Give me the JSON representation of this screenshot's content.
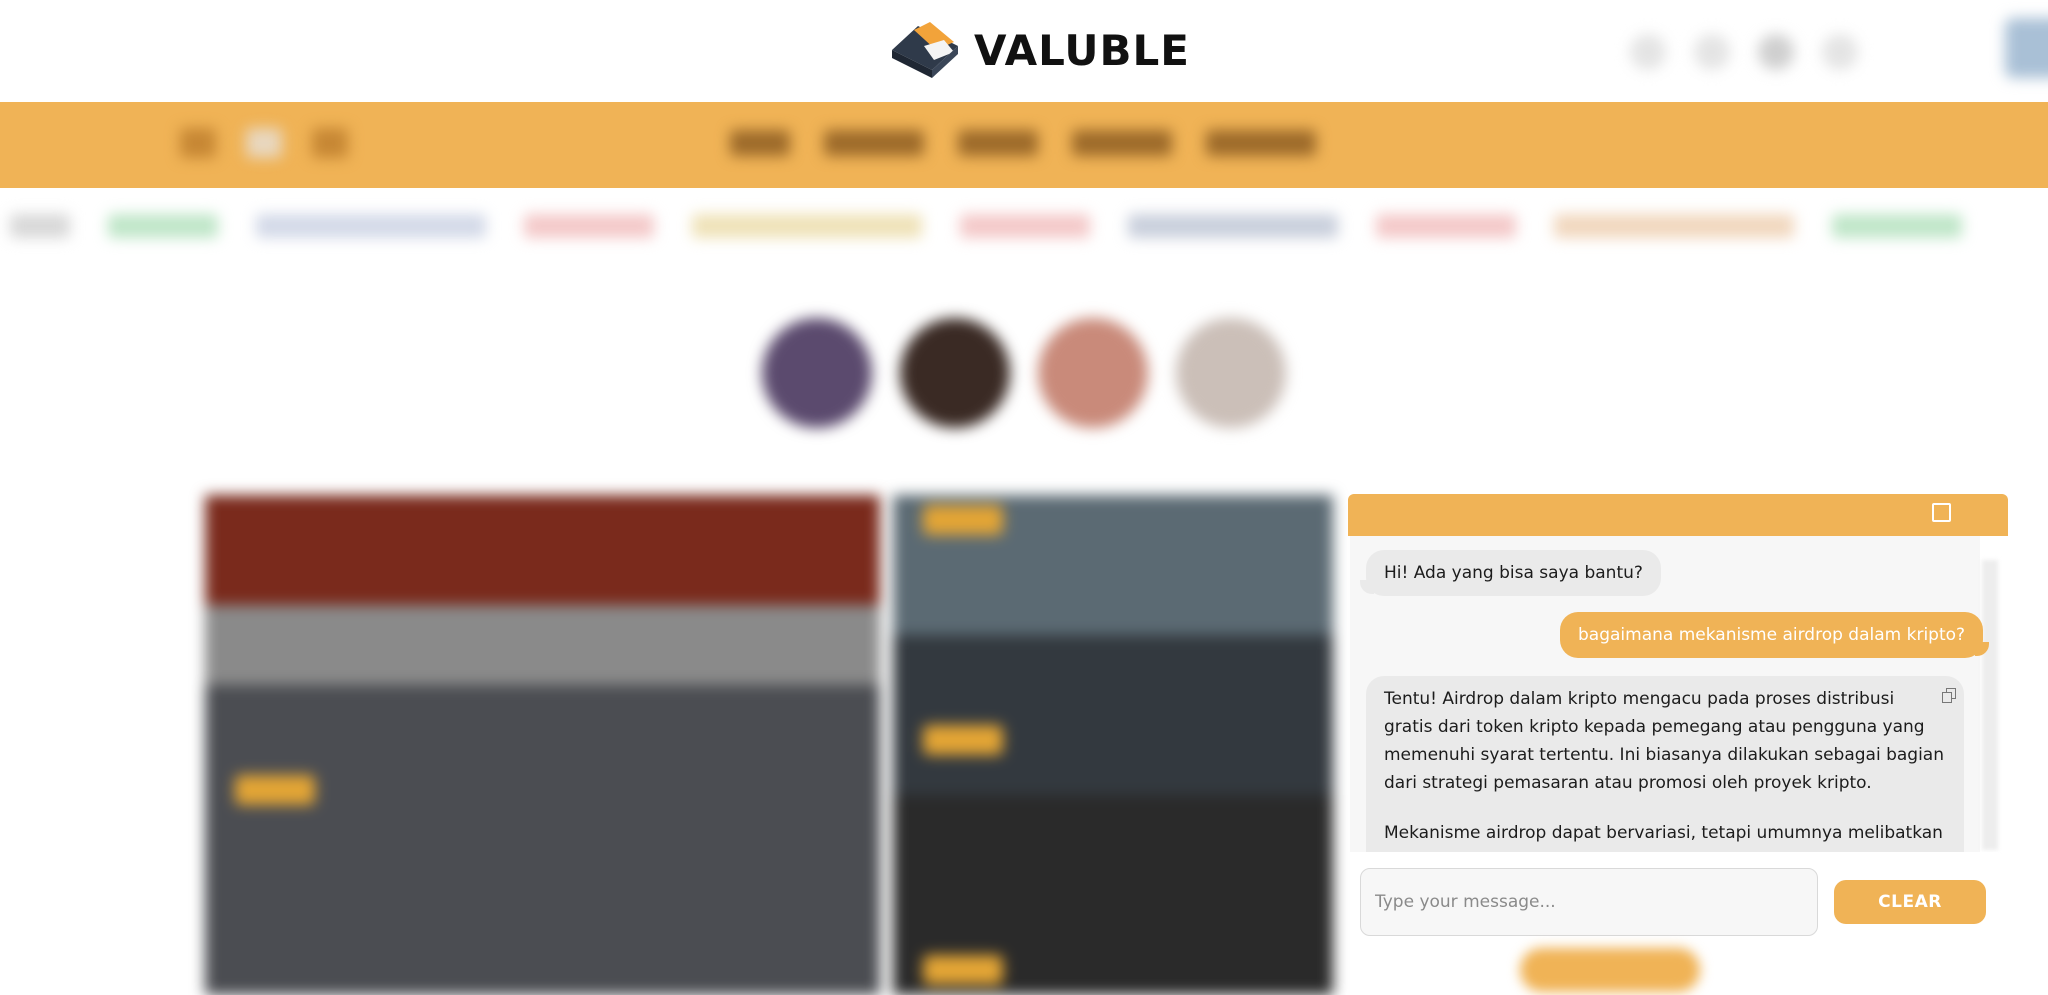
{
  "brand": {
    "name": "VALUBLE",
    "colors": {
      "accent": "#f0b356",
      "logo_dark": "#2f3a4a",
      "logo_orange": "#f2a33a",
      "logo_light": "#f4f4f4"
    }
  },
  "header": {
    "icons": [
      "search-icon",
      "globe-icon",
      "bell-icon",
      "settings-icon"
    ]
  },
  "chat": {
    "messages": [
      {
        "role": "bot",
        "text": "Hi! Ada yang bisa saya bantu?"
      },
      {
        "role": "user",
        "text": "bagaimana mekanisme airdrop dalam kripto?"
      },
      {
        "role": "bot",
        "paragraphs": [
          "Tentu! Airdrop dalam kripto mengacu pada proses distribusi gratis dari token kripto kepada pemegang atau pengguna yang memenuhi syarat tertentu. Ini biasanya dilakukan sebagai bagian dari strategi pemasaran atau promosi oleh proyek kripto.",
          "Mekanisme airdrop dapat bervariasi, tetapi umumnya melibatkan"
        ]
      }
    ],
    "input_placeholder": "Type your message...",
    "input_value": "",
    "clear_label": "CLEAR",
    "icons": {
      "expand": "expand-icon",
      "copy": "copy-icon"
    }
  }
}
